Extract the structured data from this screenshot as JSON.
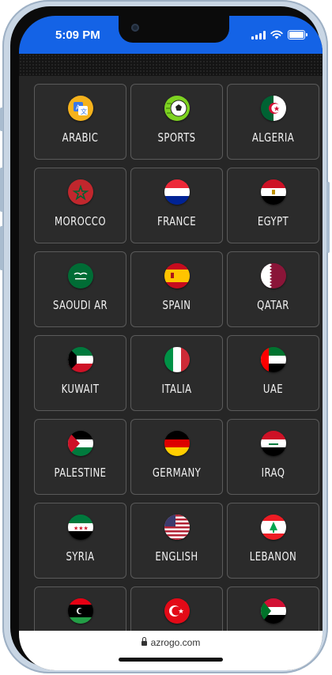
{
  "status": {
    "time": "5:09 PM"
  },
  "browser": {
    "url": "azrogo.com"
  },
  "tiles": [
    {
      "label": "ARABIC",
      "icon": "translate-icon"
    },
    {
      "label": "SPORTS",
      "icon": "soccer-ball-icon"
    },
    {
      "label": "ALGERIA",
      "icon": "algeria-flag-icon"
    },
    {
      "label": "MOROCCO",
      "icon": "morocco-flag-icon"
    },
    {
      "label": "FRANCE",
      "icon": "france-flag-icon"
    },
    {
      "label": "EGYPT",
      "icon": "egypt-flag-icon"
    },
    {
      "label": "SAOUDI AR",
      "icon": "saudi-arabia-flag-icon"
    },
    {
      "label": "SPAIN",
      "icon": "spain-flag-icon"
    },
    {
      "label": "QATAR",
      "icon": "qatar-flag-icon"
    },
    {
      "label": "KUWAIT",
      "icon": "kuwait-flag-icon"
    },
    {
      "label": "ITALIA",
      "icon": "italy-flag-icon"
    },
    {
      "label": "UAE",
      "icon": "uae-flag-icon"
    },
    {
      "label": "PALESTINE",
      "icon": "palestine-flag-icon"
    },
    {
      "label": "GERMANY",
      "icon": "germany-flag-icon"
    },
    {
      "label": "IRAQ",
      "icon": "iraq-flag-icon"
    },
    {
      "label": "SYRIA",
      "icon": "syria-flag-icon"
    },
    {
      "label": "ENGLISH",
      "icon": "usa-flag-icon"
    },
    {
      "label": "LEBANON",
      "icon": "lebanon-flag-icon"
    },
    {
      "label": "",
      "icon": "libya-flag-icon"
    },
    {
      "label": "",
      "icon": "turkey-flag-icon"
    },
    {
      "label": "",
      "icon": "sudan-flag-icon"
    }
  ],
  "colors": {
    "status_bar": "#1463e6",
    "tile_border": "#5a5a5a",
    "background": "#262626"
  }
}
